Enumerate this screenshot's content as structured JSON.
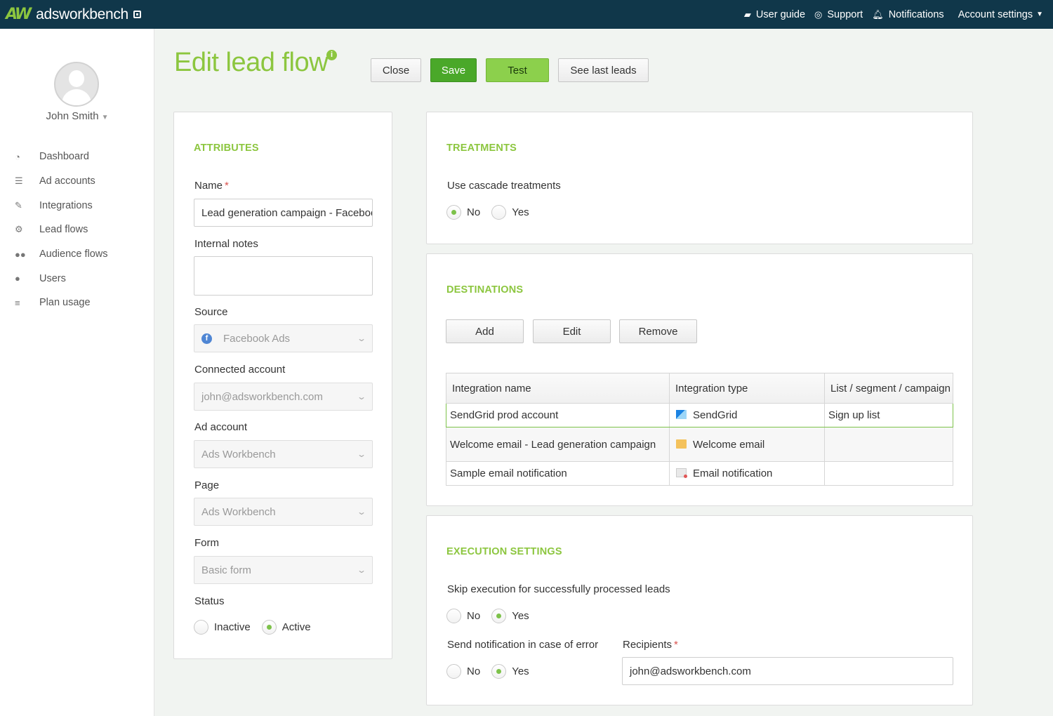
{
  "topbar": {
    "logo_mark": "AW",
    "logo_text": "adsworkbench",
    "links": {
      "user_guide": "User guide",
      "support": "Support",
      "notifications": "Notifications",
      "account_settings": "Account settings"
    }
  },
  "sidebar": {
    "user_name": "John Smith",
    "items": [
      {
        "label": "Dashboard",
        "icon": "dashboard-icon"
      },
      {
        "label": "Ad accounts",
        "icon": "database-icon"
      },
      {
        "label": "Integrations",
        "icon": "plug-icon"
      },
      {
        "label": "Lead flows",
        "icon": "gears-icon"
      },
      {
        "label": "Audience flows",
        "icon": "users-icon"
      },
      {
        "label": "Users",
        "icon": "user-icon"
      },
      {
        "label": "Plan usage",
        "icon": "list-icon"
      }
    ]
  },
  "header": {
    "title": "Edit lead flow",
    "buttons": {
      "close": "Close",
      "save": "Save",
      "test": "Test",
      "see_last_leads": "See last leads"
    }
  },
  "attributes": {
    "title": "ATTRIBUTES",
    "name_label": "Name",
    "required_mark": "*",
    "name_value": "Lead generation campaign - Facebook",
    "notes_label": "Internal notes",
    "notes_value": "",
    "source_label": "Source",
    "source_value": "Facebook Ads",
    "connected_label": "Connected account",
    "connected_value": "john@adsworkbench.com",
    "ad_account_label": "Ad account",
    "ad_account_value": "Ads Workbench",
    "page_label": "Page",
    "page_value": "Ads Workbench",
    "form_label": "Form",
    "form_value": "Basic form",
    "status_label": "Status",
    "status_options": {
      "inactive": "Inactive",
      "active": "Active"
    },
    "status_selected": "Active"
  },
  "treatments": {
    "title": "TREATMENTS",
    "cascade_label": "Use cascade treatments",
    "no": "No",
    "yes": "Yes",
    "selected": "No"
  },
  "destinations": {
    "title": "DESTINATIONS",
    "buttons": {
      "add": "Add",
      "edit": "Edit",
      "remove": "Remove"
    },
    "columns": [
      "Integration name",
      "Integration type",
      "List / segment / campaign"
    ],
    "rows": [
      {
        "name": "SendGrid prod account",
        "type": "SendGrid",
        "type_icon": "sendgrid-icon",
        "list": "Sign up list"
      },
      {
        "name": "Welcome email - Lead generation campaign",
        "type": "Welcome email",
        "type_icon": "welcome-email-icon",
        "list": ""
      },
      {
        "name": "Sample email notification",
        "type": "Email notification",
        "type_icon": "email-notification-icon",
        "list": ""
      }
    ]
  },
  "execution": {
    "title": "EXECUTION SETTINGS",
    "skip_label": "Skip execution for successfully processed leads",
    "skip_selected": "Yes",
    "notify_label": "Send notification in case of error",
    "notify_selected": "Yes",
    "no": "No",
    "yes": "Yes",
    "recipients_label": "Recipients",
    "recipients_value": "john@adsworkbench.com"
  },
  "colors": {
    "accent": "#8cc63f",
    "topbar": "#10374a",
    "save": "#4aa829"
  }
}
